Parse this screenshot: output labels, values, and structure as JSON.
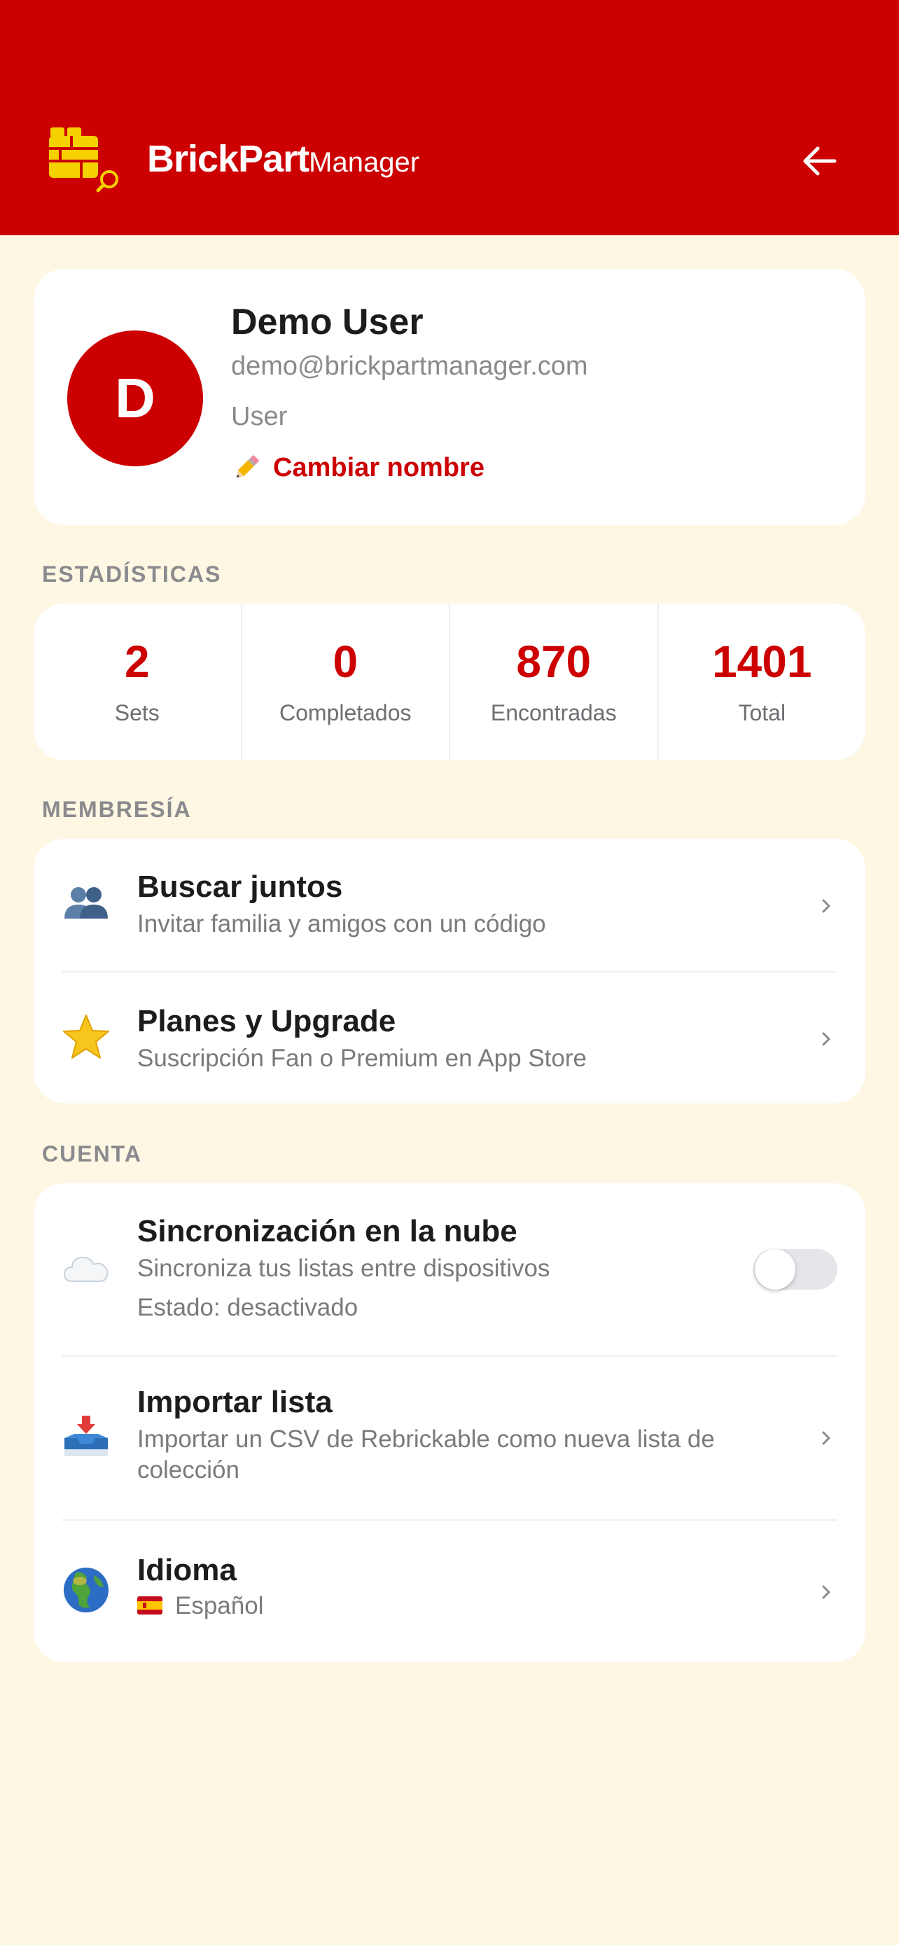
{
  "header": {
    "brand_bold": "BrickPart",
    "brand_light": "Manager",
    "logo_icon": "brick-logo-search-icon",
    "back_icon": "arrow-left-icon",
    "background": "#CC0000"
  },
  "profile": {
    "avatar_letter": "D",
    "name": "Demo User",
    "email": "demo@brickpartmanager.com",
    "role": "User",
    "rename_label": "Cambiar nombre",
    "rename_icon": "pencil-icon"
  },
  "stats": {
    "section_label": "ESTADÍSTICAS",
    "items": [
      {
        "value": "2",
        "label": "Sets"
      },
      {
        "value": "0",
        "label": "Completados"
      },
      {
        "value": "870",
        "label": "Encontradas"
      },
      {
        "value": "1401",
        "label": "Total"
      }
    ]
  },
  "membership": {
    "section_label": "MEMBRESÍA",
    "items": [
      {
        "icon": "people-icon",
        "title": "Buscar juntos",
        "subtitle": "Invitar familia y amigos con un código"
      },
      {
        "icon": "star-icon",
        "title": "Planes y Upgrade",
        "subtitle": "Suscripción Fan o Premium en App Store"
      }
    ]
  },
  "account": {
    "section_label": "CUENTA",
    "sync": {
      "icon": "cloud-icon",
      "title": "Sincronización en la nube",
      "subtitle": "Sincroniza tus listas entre dispositivos",
      "status": "Estado: desactivado",
      "enabled": false
    },
    "import": {
      "icon": "inbox-tray-icon",
      "title": "Importar lista",
      "subtitle_line1": "Importar un CSV de Rebrickable como nueva lista de",
      "subtitle_line2": "colección"
    },
    "language": {
      "icon": "globe-icon",
      "title": "Idioma",
      "flag_icon": "spain-flag-icon",
      "value": "Español"
    }
  },
  "colors": {
    "accent": "#CC0000",
    "background": "#FDF7E3"
  }
}
